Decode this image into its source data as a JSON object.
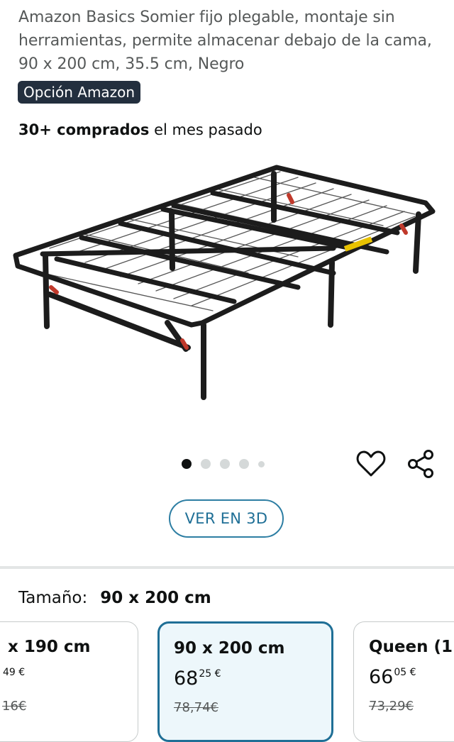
{
  "product": {
    "title": "Amazon Basics Somier fijo plegable, montaje sin herramientas, permite almacenar debajo de la cama, 90 x 200 cm, 35.5 cm, Negro",
    "badge": "Opción Amazon",
    "bought_count": "30+ comprados",
    "bought_suffix": " el mes pasado"
  },
  "gallery": {
    "image": "folding-metal-bed-frame-black",
    "current_index": 1,
    "dots": 5
  },
  "actions": {
    "view3d_label": "VER EN 3D",
    "favorite_icon": "heart-icon",
    "share_icon": "share-icon"
  },
  "size": {
    "label": "Tamaño:",
    "selected": "90 x 200 cm",
    "options": [
      {
        "name": "x 190 cm",
        "price_int": "",
        "price_dec": "49 €",
        "old_price": "16€"
      },
      {
        "name": "90 x 200 cm",
        "price_int": "68",
        "price_dec": "25 €",
        "old_price": "78,74€"
      },
      {
        "name": "Queen (1",
        "price_int": "66",
        "price_dec": "05 €",
        "old_price": "73,29€"
      }
    ]
  },
  "colors": {
    "badge_bg": "#232f3e",
    "accent": "#1f6f96",
    "selected_bg": "#edf7fb"
  }
}
